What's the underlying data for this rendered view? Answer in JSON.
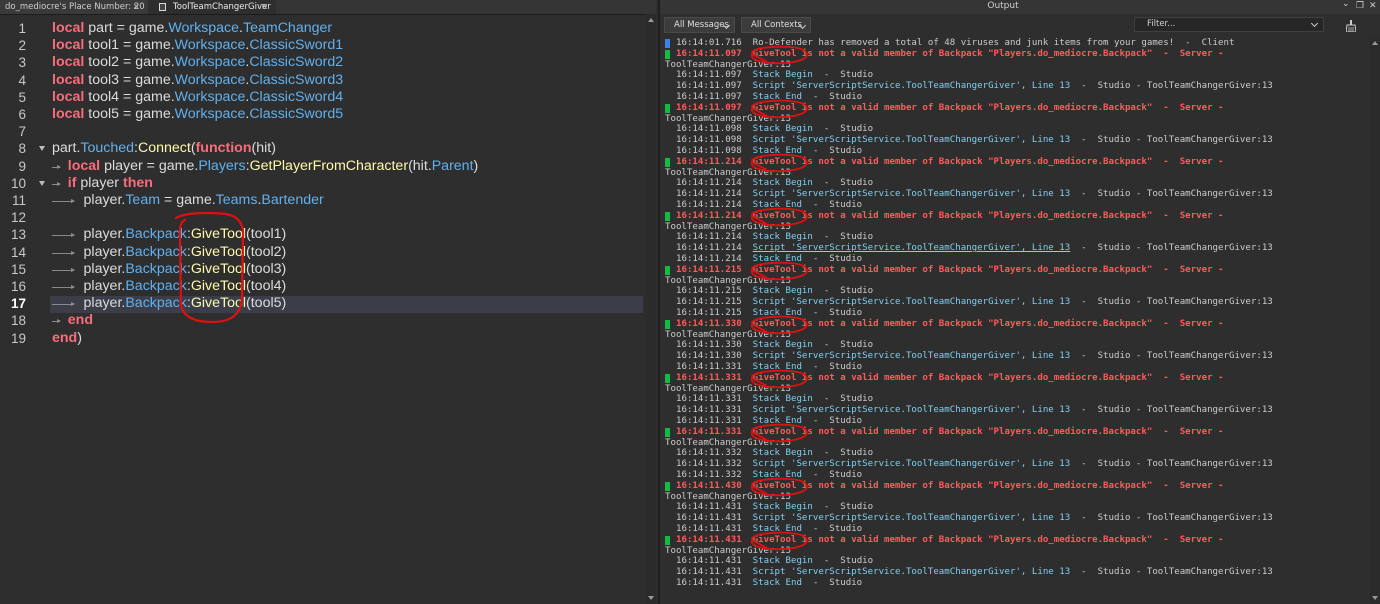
{
  "editor": {
    "tabs": [
      {
        "label": "do_mediocre's Place Number: 20",
        "close": "×"
      },
      {
        "label": "ToolTeamChangerGiver",
        "close": "×"
      }
    ],
    "current_line": 17
  },
  "output": {
    "title": "Output",
    "messages_filter": "All Messages",
    "contexts_filter": "All Contexts",
    "filter_placeholder": "Filter...",
    "window_icons": [
      "chevron-down",
      "restore",
      "close"
    ],
    "log": [
      {
        "type": "info",
        "marker": "blue",
        "time": "16:14:01.716",
        "text": "Ro-Defender has removed a total of 48 viruses and junk items from your games!  -  Client"
      },
      {
        "type": "error",
        "marker": "green",
        "time": "16:14:11.097",
        "text": "GiveTool is not a valid member of Backpack \"Players.do_mediocre.Backpack\"  -  Server -"
      },
      {
        "type": "wrap",
        "text": "ToolTeamChangerGiver:13"
      },
      {
        "type": "stack",
        "time": "16:14:11.097",
        "label": "Stack Begin",
        "suffix": "  -  Studio"
      },
      {
        "type": "script",
        "time": "16:14:11.097",
        "label": "Script 'ServerScriptService.ToolTeamChangerGiver', Line 13",
        "suffix": "  -  Studio - ToolTeamChangerGiver:13"
      },
      {
        "type": "stack",
        "time": "16:14:11.097",
        "label": "Stack End",
        "suffix": "  -  Studio"
      },
      {
        "type": "error",
        "marker": "green",
        "time": "16:14:11.097",
        "text": "GiveTool is not a valid member of Backpack \"Players.do_mediocre.Backpack\"  -  Server -"
      },
      {
        "type": "wrap",
        "text": "ToolTeamChangerGiver:13"
      },
      {
        "type": "stack",
        "time": "16:14:11.098",
        "label": "Stack Begin",
        "suffix": "  -  Studio"
      },
      {
        "type": "script",
        "time": "16:14:11.098",
        "label": "Script 'ServerScriptService.ToolTeamChangerGiver', Line 13",
        "suffix": "  -  Studio - ToolTeamChangerGiver:13"
      },
      {
        "type": "stack",
        "time": "16:14:11.098",
        "label": "Stack End",
        "suffix": "  -  Studio"
      },
      {
        "type": "error",
        "marker": "green",
        "time": "16:14:11.214",
        "text": "GiveTool is not a valid member of Backpack \"Players.do_mediocre.Backpack\"  -  Server -"
      },
      {
        "type": "wrap",
        "text": "ToolTeamChangerGiver:13"
      },
      {
        "type": "stack",
        "time": "16:14:11.214",
        "label": "Stack Begin",
        "suffix": "  -  Studio"
      },
      {
        "type": "script",
        "time": "16:14:11.214",
        "label": "Script 'ServerScriptService.ToolTeamChangerGiver', Line 13",
        "suffix": "  -  Studio - ToolTeamChangerGiver:13"
      },
      {
        "type": "stack",
        "time": "16:14:11.214",
        "label": "Stack End",
        "suffix": "  -  Studio"
      },
      {
        "type": "error",
        "marker": "green",
        "time": "16:14:11.214",
        "text": "GiveTool is not a valid member of Backpack \"Players.do_mediocre.Backpack\"  -  Server -"
      },
      {
        "type": "wrap",
        "text": "ToolTeamChangerGiver:13"
      },
      {
        "type": "stack",
        "time": "16:14:11.214",
        "label": "Stack Begin",
        "suffix": "  -  Studio"
      },
      {
        "type": "script",
        "time": "16:14:11.214",
        "label": "Script 'ServerScriptService.ToolTeamChangerGiver', Line 13",
        "suffix": "  -  Studio - ToolTeamChangerGiver:13",
        "underline": true
      },
      {
        "type": "stack",
        "time": "16:14:11.214",
        "label": "Stack End",
        "suffix": "  -  Studio"
      },
      {
        "type": "error",
        "marker": "green",
        "time": "16:14:11.215",
        "text": "GiveTool is not a valid member of Backpack \"Players.do_mediocre.Backpack\"  -  Server -"
      },
      {
        "type": "wrap",
        "text": "ToolTeamChangerGiver:13"
      },
      {
        "type": "stack",
        "time": "16:14:11.215",
        "label": "Stack Begin",
        "suffix": "  -  Studio"
      },
      {
        "type": "script",
        "time": "16:14:11.215",
        "label": "Script 'ServerScriptService.ToolTeamChangerGiver', Line 13",
        "suffix": "  -  Studio - ToolTeamChangerGiver:13"
      },
      {
        "type": "stack",
        "time": "16:14:11.215",
        "label": "Stack End",
        "suffix": "  -  Studio"
      },
      {
        "type": "error",
        "marker": "green",
        "time": "16:14:11.330",
        "text": "GiveTool is not a valid member of Backpack \"Players.do_mediocre.Backpack\"  -  Server -"
      },
      {
        "type": "wrap",
        "text": "ToolTeamChangerGiver:13"
      },
      {
        "type": "stack",
        "time": "16:14:11.330",
        "label": "Stack Begin",
        "suffix": "  -  Studio"
      },
      {
        "type": "script",
        "time": "16:14:11.330",
        "label": "Script 'ServerScriptService.ToolTeamChangerGiver', Line 13",
        "suffix": "  -  Studio - ToolTeamChangerGiver:13"
      },
      {
        "type": "stack",
        "time": "16:14:11.331",
        "label": "Stack End",
        "suffix": "  -  Studio"
      },
      {
        "type": "error",
        "marker": "green",
        "time": "16:14:11.331",
        "text": "GiveTool is not a valid member of Backpack \"Players.do_mediocre.Backpack\"  -  Server -"
      },
      {
        "type": "wrap",
        "text": "ToolTeamChangerGiver:13"
      },
      {
        "type": "stack",
        "time": "16:14:11.331",
        "label": "Stack Begin",
        "suffix": "  -  Studio"
      },
      {
        "type": "script",
        "time": "16:14:11.331",
        "label": "Script 'ServerScriptService.ToolTeamChangerGiver', Line 13",
        "suffix": "  -  Studio - ToolTeamChangerGiver:13"
      },
      {
        "type": "stack",
        "time": "16:14:11.331",
        "label": "Stack End",
        "suffix": "  -  Studio"
      },
      {
        "type": "error",
        "marker": "green",
        "time": "16:14:11.331",
        "text": "GiveTool is not a valid member of Backpack \"Players.do_mediocre.Backpack\"  -  Server -"
      },
      {
        "type": "wrap",
        "text": "ToolTeamChangerGiver:13"
      },
      {
        "type": "stack",
        "time": "16:14:11.332",
        "label": "Stack Begin",
        "suffix": "  -  Studio"
      },
      {
        "type": "script",
        "time": "16:14:11.332",
        "label": "Script 'ServerScriptService.ToolTeamChangerGiver', Line 13",
        "suffix": "  -  Studio - ToolTeamChangerGiver:13"
      },
      {
        "type": "stack",
        "time": "16:14:11.332",
        "label": "Stack End",
        "suffix": "  -  Studio"
      },
      {
        "type": "error",
        "marker": "green",
        "time": "16:14:11.430",
        "text": "GiveTool is not a valid member of Backpack \"Players.do_mediocre.Backpack\"  -  Server -"
      },
      {
        "type": "wrap",
        "text": "ToolTeamChangerGiver:13"
      },
      {
        "type": "stack",
        "time": "16:14:11.431",
        "label": "Stack Begin",
        "suffix": "  -  Studio"
      },
      {
        "type": "script",
        "time": "16:14:11.431",
        "label": "Script 'ServerScriptService.ToolTeamChangerGiver', Line 13",
        "suffix": "  -  Studio - ToolTeamChangerGiver:13"
      },
      {
        "type": "stack",
        "time": "16:14:11.431",
        "label": "Stack End",
        "suffix": "  -  Studio"
      },
      {
        "type": "error",
        "marker": "green",
        "time": "16:14:11.431",
        "text": "GiveTool is not a valid member of Backpack \"Players.do_mediocre.Backpack\"  -  Server -"
      },
      {
        "type": "wrap",
        "text": "ToolTeamChangerGiver:13"
      },
      {
        "type": "stack",
        "time": "16:14:11.431",
        "label": "Stack Begin",
        "suffix": "  -  Studio"
      },
      {
        "type": "script",
        "time": "16:14:11.431",
        "label": "Script 'ServerScriptService.ToolTeamChangerGiver', Line 13",
        "suffix": "  -  Studio - ToolTeamChangerGiver:13"
      },
      {
        "type": "stack",
        "time": "16:14:11.431",
        "label": "Stack End",
        "suffix": "  -  Studio"
      }
    ]
  },
  "code": [
    {
      "n": "1",
      "fold": false,
      "segs": [
        [
          "kw",
          "local"
        ],
        [
          "t",
          " part = game."
        ],
        [
          "mem",
          "Workspace"
        ],
        [
          "t",
          "."
        ],
        [
          "mem",
          "TeamChanger"
        ]
      ]
    },
    {
      "n": "2",
      "fold": false,
      "segs": [
        [
          "kw",
          "local"
        ],
        [
          "t",
          " tool1 = game."
        ],
        [
          "mem",
          "Workspace"
        ],
        [
          "t",
          "."
        ],
        [
          "mem",
          "ClassicSword1"
        ]
      ]
    },
    {
      "n": "3",
      "fold": false,
      "segs": [
        [
          "kw",
          "local"
        ],
        [
          "t",
          " tool2 = game."
        ],
        [
          "mem",
          "Workspace"
        ],
        [
          "t",
          "."
        ],
        [
          "mem",
          "ClassicSword2"
        ]
      ]
    },
    {
      "n": "4",
      "fold": false,
      "segs": [
        [
          "kw",
          "local"
        ],
        [
          "t",
          " tool3 = game."
        ],
        [
          "mem",
          "Workspace"
        ],
        [
          "t",
          "."
        ],
        [
          "mem",
          "ClassicSword3"
        ]
      ]
    },
    {
      "n": "5",
      "fold": false,
      "segs": [
        [
          "kw",
          "local"
        ],
        [
          "t",
          " tool4 = game."
        ],
        [
          "mem",
          "Workspace"
        ],
        [
          "t",
          "."
        ],
        [
          "mem",
          "ClassicSword4"
        ]
      ]
    },
    {
      "n": "6",
      "fold": false,
      "segs": [
        [
          "kw",
          "local"
        ],
        [
          "t",
          " tool5 = game."
        ],
        [
          "mem",
          "Workspace"
        ],
        [
          "t",
          "."
        ],
        [
          "mem",
          "ClassicSword5"
        ]
      ]
    },
    {
      "n": "7",
      "fold": false,
      "segs": []
    },
    {
      "n": "8",
      "fold": true,
      "segs": [
        [
          "t",
          "part."
        ],
        [
          "mem",
          "Touched"
        ],
        [
          "t",
          ":"
        ],
        [
          "fn",
          "Connect"
        ],
        [
          "t",
          "("
        ],
        [
          "kw",
          "function"
        ],
        [
          "t",
          "(hit)"
        ]
      ]
    },
    {
      "n": "9",
      "fold": false,
      "segs": [
        [
          "t",
          "    "
        ],
        [
          "kw",
          "local"
        ],
        [
          "t",
          " player = game."
        ],
        [
          "mem",
          "Players"
        ],
        [
          "t",
          ":"
        ],
        [
          "fn",
          "GetPlayerFromCharacter"
        ],
        [
          "t",
          "(hit."
        ],
        [
          "mem",
          "Parent"
        ],
        [
          "t",
          ")"
        ]
      ]
    },
    {
      "n": "10",
      "fold": true,
      "segs": [
        [
          "t",
          "    "
        ],
        [
          "kw",
          "if"
        ],
        [
          "t",
          " player "
        ],
        [
          "kw",
          "then"
        ]
      ]
    },
    {
      "n": "11",
      "fold": false,
      "segs": [
        [
          "t",
          "        player."
        ],
        [
          "mem",
          "Team"
        ],
        [
          "t",
          " = game."
        ],
        [
          "mem",
          "Teams"
        ],
        [
          "t",
          "."
        ],
        [
          "mem",
          "Bartender"
        ]
      ]
    },
    {
      "n": "12",
      "fold": false,
      "segs": []
    },
    {
      "n": "13",
      "fold": false,
      "segs": [
        [
          "t",
          "        player."
        ],
        [
          "mem",
          "Backpack"
        ],
        [
          "t",
          ":"
        ],
        [
          "fn",
          "GiveTool"
        ],
        [
          "t",
          "(tool1)"
        ]
      ]
    },
    {
      "n": "14",
      "fold": false,
      "segs": [
        [
          "t",
          "        player."
        ],
        [
          "mem",
          "Backpack"
        ],
        [
          "t",
          ":"
        ],
        [
          "fn",
          "GiveTool"
        ],
        [
          "t",
          "(tool2)"
        ]
      ]
    },
    {
      "n": "15",
      "fold": false,
      "segs": [
        [
          "t",
          "        player."
        ],
        [
          "mem",
          "Backpack"
        ],
        [
          "t",
          ":"
        ],
        [
          "fn",
          "GiveTool"
        ],
        [
          "t",
          "(tool3)"
        ]
      ]
    },
    {
      "n": "16",
      "fold": false,
      "segs": [
        [
          "t",
          "        player."
        ],
        [
          "mem",
          "Backpack"
        ],
        [
          "t",
          ":"
        ],
        [
          "fn",
          "GiveTool"
        ],
        [
          "t",
          "(tool4)"
        ]
      ]
    },
    {
      "n": "17",
      "fold": false,
      "segs": [
        [
          "t",
          "        player."
        ],
        [
          "mem",
          "Backpack"
        ],
        [
          "t",
          ":"
        ],
        [
          "fn",
          "GiveTool"
        ],
        [
          "t",
          "(tool5)"
        ]
      ]
    },
    {
      "n": "18",
      "fold": false,
      "segs": [
        [
          "t",
          "    "
        ],
        [
          "kw",
          "end"
        ]
      ]
    },
    {
      "n": "19",
      "fold": false,
      "segs": [
        [
          "kw",
          "end"
        ],
        [
          "t",
          ")"
        ]
      ]
    }
  ],
  "colors": {
    "keyword": "#f86d7c",
    "member": "#62b0ee",
    "method": "#fdfbac",
    "error": "#ff5a5a",
    "stack_label": "#7fd0f2",
    "annotation": "#e01010"
  }
}
